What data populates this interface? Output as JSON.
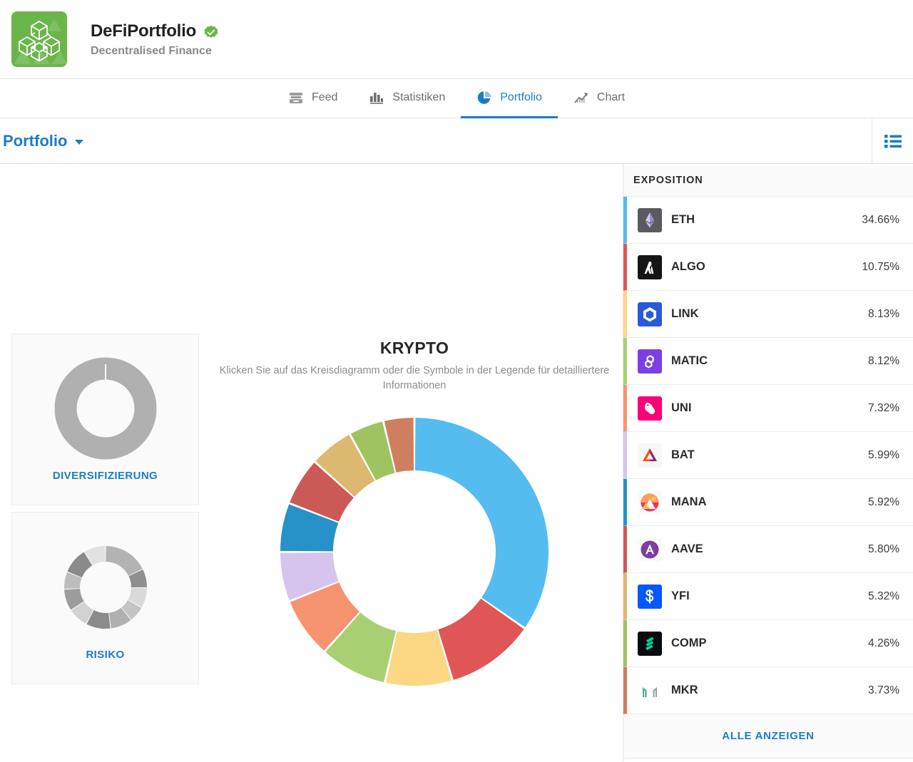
{
  "header": {
    "app_name": "DeFiPortfolio",
    "subtitle": "Decentralised Finance",
    "logo_bg": "#6ab64b",
    "verified_color": "#6ab64b",
    "logo_icon": "blockchain-cubes-icon",
    "verified_icon": "verified-badge-icon"
  },
  "tabs": [
    {
      "label": "Feed",
      "icon": "feed-icon",
      "active": false
    },
    {
      "label": "Statistiken",
      "icon": "bar-chart-icon",
      "active": false
    },
    {
      "label": "Portfolio",
      "icon": "pie-chart-icon",
      "active": true
    },
    {
      "label": "Chart",
      "icon": "trend-up-icon",
      "active": false
    }
  ],
  "subbar": {
    "portfolio_label": "Portfolio",
    "caret_icon": "chevron-down-icon",
    "list_toggle_icon": "list-view-icon",
    "accent": "#1a7dc4"
  },
  "score_cards": [
    {
      "label": "DIVERSIFIZIERUNG",
      "ring_color": "#b0b0b0"
    },
    {
      "label": "RISIKO",
      "ring_color": "#9a9a9a"
    }
  ],
  "krypto": {
    "title": "KRYPTO",
    "description": "Klicken Sie auf das Kreisdiagramm oder die Symbole in der Legende für detailliertere Informationen"
  },
  "exposition": {
    "header": "EXPOSITION",
    "show_all_label": "ALLE ANZEIGEN"
  },
  "chart_data": {
    "type": "pie",
    "title": "KRYPTO",
    "subtitle": "Klicken Sie auf das Kreisdiagramm oder die Symbole in der Legende für detailliertere Informationen",
    "legend_position": "right",
    "units": "percent",
    "categories": [
      "ETH",
      "ALGO",
      "LINK",
      "MATIC",
      "UNI",
      "BAT",
      "MANA",
      "AAVE",
      "YFI",
      "COMP",
      "MKR"
    ],
    "values": [
      34.66,
      10.75,
      8.13,
      8.12,
      7.32,
      5.99,
      5.92,
      5.8,
      5.32,
      4.26,
      3.73
    ],
    "labels": [
      "34.66%",
      "10.75%",
      "8.13%",
      "8.12%",
      "7.32%",
      "5.99%",
      "5.92%",
      "5.80%",
      "5.32%",
      "4.26%",
      "3.73%"
    ],
    "colors": [
      "#55bcf0",
      "#e05656",
      "#fcd784",
      "#a8d072",
      "#f79470",
      "#d6c4ee",
      "#2792c9",
      "#cb5a56",
      "#ddb871",
      "#9fc361",
      "#cf7f5f"
    ],
    "icon_names": [
      "eth-icon",
      "algo-icon",
      "link-icon",
      "matic-icon",
      "uni-icon",
      "bat-icon",
      "mana-icon",
      "aave-icon",
      "yfi-icon",
      "comp-icon",
      "mkr-icon"
    ]
  },
  "risk_ring_segments": [
    {
      "sweep": 62,
      "color": "#b3b3b3"
    },
    {
      "sweep": 26,
      "color": "#8f8f8f"
    },
    {
      "sweep": 28,
      "color": "#d9d9d9"
    },
    {
      "sweep": 22,
      "color": "#c4c4c4"
    },
    {
      "sweep": 30,
      "color": "#b0b0b0"
    },
    {
      "sweep": 34,
      "color": "#8c8c8c"
    },
    {
      "sweep": 28,
      "color": "#d2d2d2"
    },
    {
      "sweep": 30,
      "color": "#9c9c9c"
    },
    {
      "sweep": 24,
      "color": "#bdbdbd"
    },
    {
      "sweep": 36,
      "color": "#8a8a8a"
    },
    {
      "sweep": 30,
      "color": "#e2e2e2"
    }
  ]
}
